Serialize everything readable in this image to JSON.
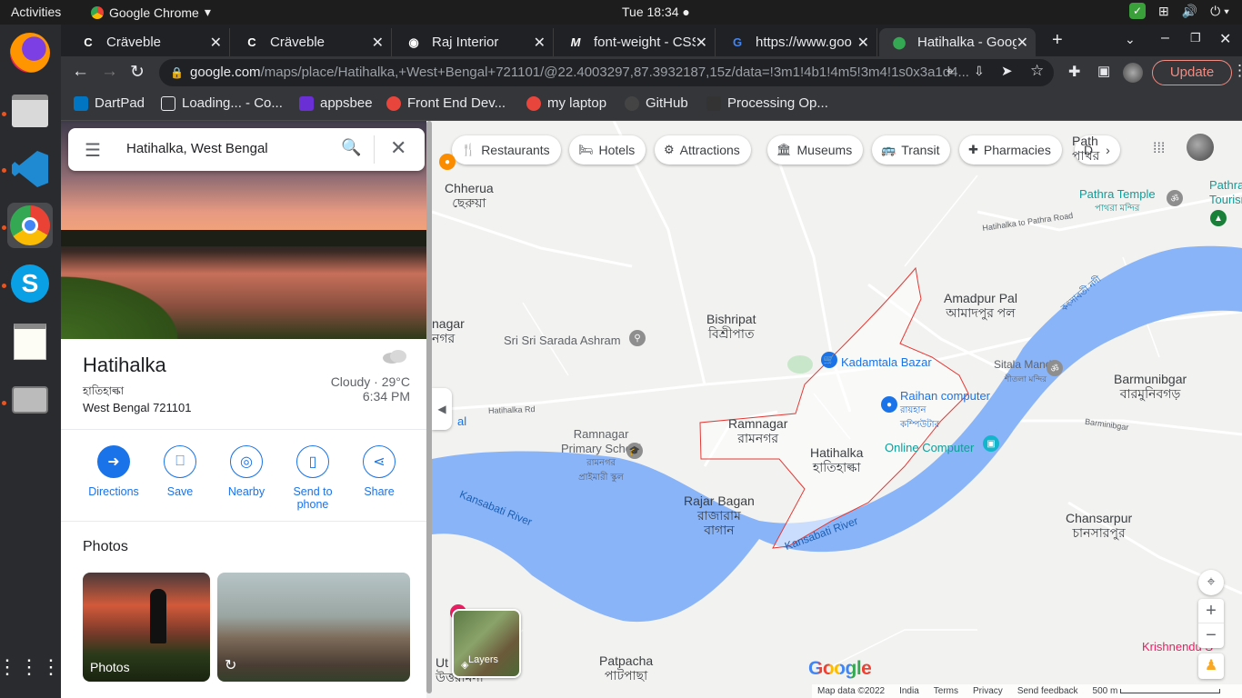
{
  "topbar": {
    "activities": "Activities",
    "app_name": "Google Chrome",
    "clock": "Tue 18:34"
  },
  "tabs": [
    {
      "title": "Cräveble",
      "icon": "craveble-icon"
    },
    {
      "title": "Cräveble",
      "icon": "craveble-icon"
    },
    {
      "title": "Raj Interior",
      "icon": "globe-icon"
    },
    {
      "title": "font-weight - CSS",
      "icon": "mdn-icon"
    },
    {
      "title": "https://www.goo",
      "icon": "google-icon"
    },
    {
      "title": "Hatihalka - Goog",
      "icon": "maps-icon"
    }
  ],
  "toolbar": {
    "url_host": "google.com",
    "url_path": "/maps/place/Hatihalka,+West+Bengal+721101/@22.4003297,87.3932187,15z/data=!3m1!4b1!4m5!3m4!1s0x3a1d4...",
    "update_label": "Update"
  },
  "bookmarks": [
    {
      "label": "DartPad",
      "color": "#0175c2"
    },
    {
      "label": "Loading... - Co...",
      "color": "#202124"
    },
    {
      "label": "appsbee",
      "color": "#6b2fd6"
    },
    {
      "label": "Front End Dev...",
      "color": "#e8453c"
    },
    {
      "label": "my laptop",
      "color": "#e8453c"
    },
    {
      "label": "GitHub",
      "color": "#444"
    },
    {
      "label": "Processing Op...",
      "color": "#333"
    }
  ],
  "search": {
    "query": "Hatihalka, West Bengal"
  },
  "place": {
    "name": "Hatihalka",
    "name_bn": "হাতিহাল্কা",
    "address": "West Bengal 721101",
    "weather": "Cloudy · 29°C",
    "time": "6:34 PM"
  },
  "actions": [
    {
      "label": "Directions"
    },
    {
      "label": "Save"
    },
    {
      "label": "Nearby"
    },
    {
      "label": "Send to phone"
    },
    {
      "label": "Share"
    }
  ],
  "photos": {
    "heading": "Photos",
    "thumb1_label": "Photos"
  },
  "chips": [
    {
      "label": "Restaurants",
      "icon": "fork-knife-icon"
    },
    {
      "label": "Hotels",
      "icon": "bed-icon"
    },
    {
      "label": "Attractions",
      "icon": "camera-icon"
    },
    {
      "label": "Museums",
      "icon": "museum-icon"
    },
    {
      "label": "Transit",
      "icon": "bus-icon"
    },
    {
      "label": "Pharmacies",
      "icon": "pharmacy-icon"
    },
    {
      "label": "D",
      "icon": "more-icon"
    }
  ],
  "map_labels": {
    "chherua": "Chherua",
    "chherua_bn": "ছেরুয়া",
    "pathra_temple": "Pathra Temple",
    "pathra_temple_bn": "পাথরা মন্দির",
    "pathra_tourism": "Pathra R\nTourism",
    "pathra": "Path\nপাথর",
    "hatihalka_pathra_road": "Hatihalka to Pathra Road",
    "agar": "nagar\nনগর",
    "sarada": "Sri Sri Sarada Ashram",
    "bishripat": "Bishripat",
    "bishripat_bn": "বিশ্রীপাত",
    "amadpur": "Amadpur Pal",
    "amadpur_bn": "আমাদপুর পল",
    "kadamtala": "Kadamtala Bazar",
    "sitala": "Sitala Mandir",
    "sitala_bn": "শীতলা মন্দির",
    "barmunibgar": "Barmunibgar",
    "barmunibgar_bn": "বারমুনিবগড়",
    "raihan": "Raihan computer",
    "raihan_bn": "রায়হান\nকম্পিউটার",
    "hatihalka_rd": "Hatihalka Rd",
    "ramnagar": "Ramnagar",
    "ramnagar_bn": "রামনগর",
    "ramnagar_school": "Ramnagar\nPrimary School",
    "ramnagar_school_bn": "রামনগর\nপ্রাইমারী স্কুল",
    "hatihalka": "Hatihalka",
    "hatihalka_bn": "হাতিহাল্কা",
    "online_computer": "Online Computer",
    "barminibgar_small": "Barminibgar",
    "rajar_bagan": "Rajar Bagan",
    "rajar_bagan_bn": "রাজারাম\nবাগান",
    "kansabati1": "Kansabati River",
    "kansabati2": "Kansabati River",
    "kansabati_bn": "কংসাবতী নদী",
    "chansarpur": "Chansarpur",
    "chansarpur_bn": "চানসারপুর",
    "patpacha": "Patpacha",
    "patpacha_bn": "পাটপাছা",
    "ut": "Ut\nউত্তরামনা",
    "krishnend": "Krishnendu S",
    "al": "al"
  },
  "map_ui": {
    "layers": "Layers",
    "google": "Google",
    "footer_data": "Map data ©2022",
    "footer_india": "India",
    "footer_terms": "Terms",
    "footer_privacy": "Privacy",
    "footer_feedback": "Send feedback",
    "footer_scale": "500 m"
  },
  "colors": {
    "water": "#8ab4f8",
    "boundary": "#e53935",
    "link_blue": "#1a73e8"
  }
}
